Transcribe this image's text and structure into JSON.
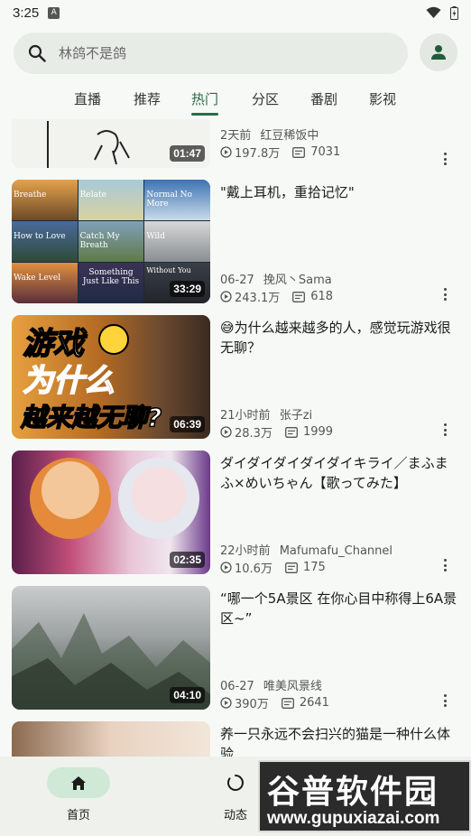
{
  "status": {
    "time": "3:25",
    "notification_badge": "A"
  },
  "search": {
    "placeholder": "林鸽不是鸽"
  },
  "tabs": [
    {
      "label": "直播"
    },
    {
      "label": "推荐"
    },
    {
      "label": "热门",
      "active": true
    },
    {
      "label": "分区"
    },
    {
      "label": "番剧"
    },
    {
      "label": "影视"
    }
  ],
  "videos": [
    {
      "title": "",
      "duration": "01:47",
      "time": "2天前",
      "author": "红豆稀饭中",
      "views": "197.8万",
      "danmaku": "7031"
    },
    {
      "title": "\"戴上耳机，重拾记忆\"",
      "duration": "33:29",
      "time": "06-27",
      "author": "挽风丶Sama",
      "views": "243.1万",
      "danmaku": "618",
      "thumb_texts": [
        "Breathe",
        "Relate",
        "Normal No More",
        "How to Love",
        "Catch My Breath",
        "Wild",
        "Wake Level",
        "Something Just Like This",
        "Without You"
      ]
    },
    {
      "title": "😅为什么越来越多的人，感觉玩游戏很无聊？",
      "duration": "06:39",
      "time": "21小时前",
      "author": "张子zi",
      "views": "28.3万",
      "danmaku": "1999",
      "thumb_texts": [
        "游戏",
        "为什么",
        "越来越无聊?"
      ]
    },
    {
      "title": "ダイダイダイダイダイキライ／まふまふ×めいちゃん【歌ってみた】",
      "duration": "02:35",
      "time": "22小时前",
      "author": "Mafumafu_Channel",
      "views": "10.6万",
      "danmaku": "175"
    },
    {
      "title": "“哪一个5A景区 在你心目中称得上6A景区~”",
      "duration": "04:10",
      "time": "06-27",
      "author": "唯美风景线",
      "views": "390万",
      "danmaku": "2641"
    },
    {
      "title": "养一只永远不会扫兴的猫是一种什么体验...",
      "duration": "",
      "time": "",
      "author": "",
      "views": "",
      "danmaku": ""
    }
  ],
  "bottom_nav": [
    {
      "label": "首页",
      "icon": "home-icon",
      "active": true
    },
    {
      "label": "动态",
      "icon": "dynamic-icon"
    }
  ],
  "watermark": {
    "brand": "谷普软件园",
    "url": "www.gupuxiazai.com"
  },
  "colors": {
    "accent": "#2a6b48",
    "active_pill": "#cfe9d6",
    "search_bg": "#e8ece6"
  }
}
